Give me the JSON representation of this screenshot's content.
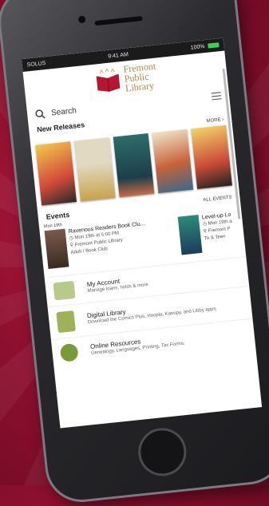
{
  "status": {
    "carrier": "SOLUS",
    "time": "9:41 AM",
    "battery": "100%"
  },
  "logo": {
    "line1": "Fremont",
    "line2": "Public",
    "line3": "Library"
  },
  "search": {
    "label": "Search"
  },
  "new_releases": {
    "title": "New Releases",
    "more": "MORE ›"
  },
  "covers": [
    {
      "color": "#d24a3a"
    },
    {
      "color": "#e2d9c3"
    },
    {
      "color": "#2e6c6a"
    },
    {
      "color": "#c8623a"
    },
    {
      "color": "#c94b38"
    }
  ],
  "events": {
    "title": "Events",
    "all": "ALL EVENTS",
    "date_label": "Mon 19th",
    "items": [
      {
        "title": "Ravenous Readers Book Clu...",
        "time": "Mon 19th at 5:00 PM",
        "place": "Fremont Public Library",
        "tag": "Adult / Book Club"
      },
      {
        "title": "Level-up Lo",
        "time": "Mon 19th a",
        "place": "Fremont P",
        "tag": "Tk & Teen"
      }
    ]
  },
  "menu": [
    {
      "title": "My Account",
      "desc": "Manage loans, holds & more"
    },
    {
      "title": "Digital Library",
      "desc": "Download the Comics Plus, Hoopla, Kanopy, and Libby apps."
    },
    {
      "title": "Online Resources",
      "desc": "Genealogy, Languages, Printing, Tax Forms,"
    }
  ]
}
